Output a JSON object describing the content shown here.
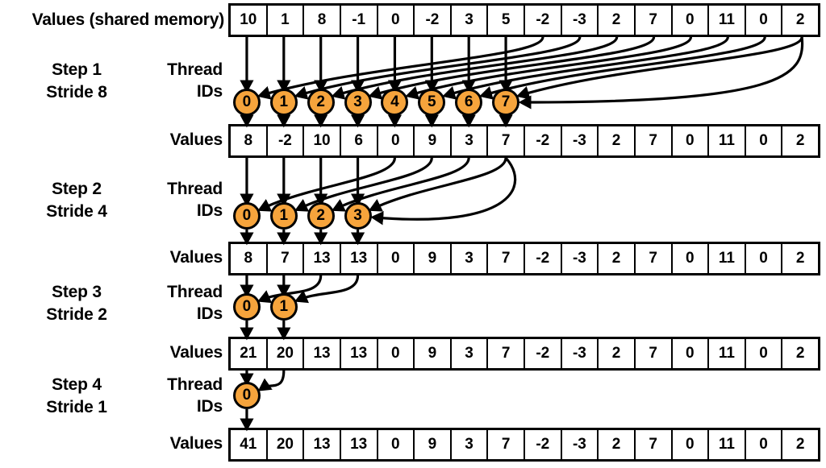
{
  "diagram": {
    "title_left_label": "Values (shared memory)",
    "thread_caption": "Thread\nIDs",
    "values_caption": "Values",
    "accent_color": "#F6A43C",
    "line_color": "#000000",
    "array_length": 16
  },
  "captions": {
    "shared_memory": "Values (shared memory)",
    "thread_ids_line1": "Thread",
    "thread_ids_line2": "IDs",
    "values": "Values"
  },
  "steps": [
    {
      "step_label_line1": "Step 1",
      "step_label_line2": "Stride 8",
      "stride": 8,
      "thread_ids": [
        "0",
        "1",
        "2",
        "3",
        "4",
        "5",
        "6",
        "7"
      ],
      "result_values": [
        "8",
        "-2",
        "10",
        "6",
        "0",
        "9",
        "3",
        "7",
        "-2",
        "-3",
        "2",
        "7",
        "0",
        "11",
        "0",
        "2"
      ]
    },
    {
      "step_label_line1": "Step 2",
      "step_label_line2": "Stride 4",
      "stride": 4,
      "thread_ids": [
        "0",
        "1",
        "2",
        "3"
      ],
      "result_values": [
        "8",
        "7",
        "13",
        "13",
        "0",
        "9",
        "3",
        "7",
        "-2",
        "-3",
        "2",
        "7",
        "0",
        "11",
        "0",
        "2"
      ]
    },
    {
      "step_label_line1": "Step 3",
      "step_label_line2": "Stride 2",
      "stride": 2,
      "thread_ids": [
        "0",
        "1"
      ],
      "result_values": [
        "21",
        "20",
        "13",
        "13",
        "0",
        "9",
        "3",
        "7",
        "-2",
        "-3",
        "2",
        "7",
        "0",
        "11",
        "0",
        "2"
      ]
    },
    {
      "step_label_line1": "Step 4",
      "step_label_line2": "Stride 1",
      "stride": 1,
      "thread_ids": [
        "0"
      ],
      "result_values": [
        "41",
        "20",
        "13",
        "13",
        "0",
        "9",
        "3",
        "7",
        "-2",
        "-3",
        "2",
        "7",
        "0",
        "11",
        "0",
        "2"
      ]
    }
  ],
  "initial_values": [
    "10",
    "1",
    "8",
    "-1",
    "0",
    "-2",
    "3",
    "5",
    "-2",
    "-3",
    "2",
    "7",
    "0",
    "11",
    "0",
    "2"
  ]
}
